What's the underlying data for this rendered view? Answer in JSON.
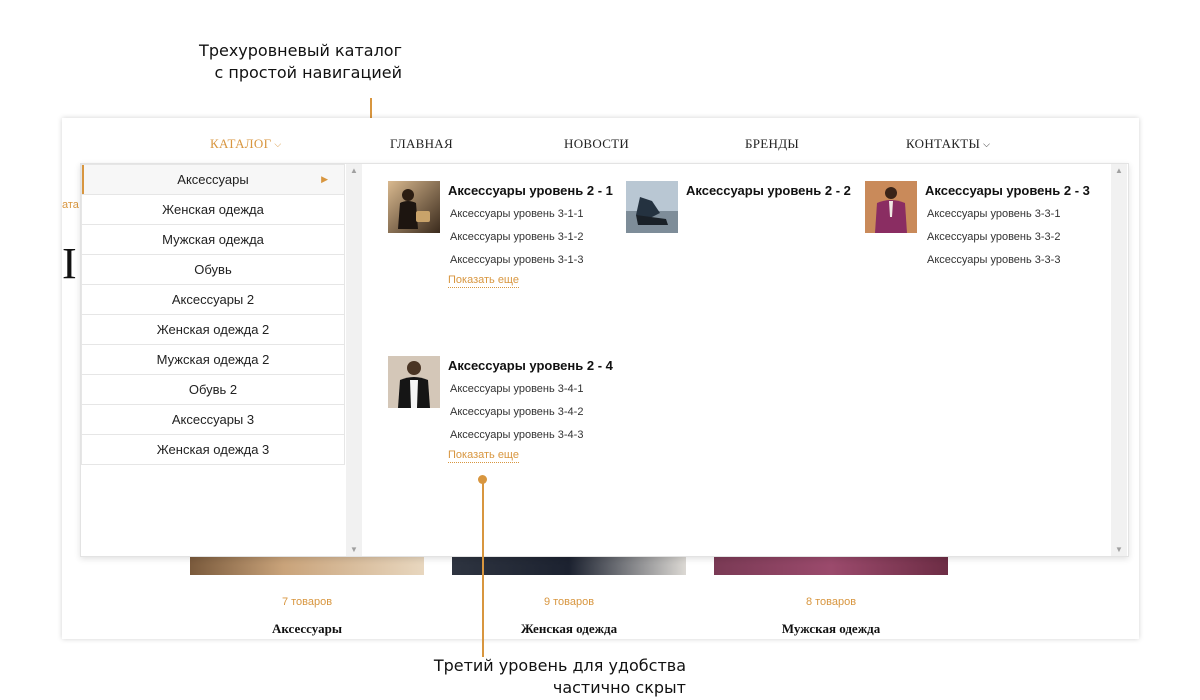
{
  "annotations": {
    "top_line1": "Трехуровневый каталог",
    "top_line2": "с простой навигацией",
    "bottom_line1": "Третий уровень для удобства",
    "bottom_line2": "частично скрыт"
  },
  "nav": {
    "items": [
      {
        "label": "КАТАЛОГ",
        "has_dropdown": true,
        "active": true
      },
      {
        "label": "ГЛАВНАЯ",
        "has_dropdown": false
      },
      {
        "label": "НОВОСТИ",
        "has_dropdown": false
      },
      {
        "label": "БРЕНДЫ",
        "has_dropdown": false
      },
      {
        "label": "КОНТАКТЫ",
        "has_dropdown": true
      }
    ]
  },
  "background": {
    "crumb": "ата",
    "letter": "I",
    "categories": [
      {
        "count": "7 товаров",
        "name": "Аксессуары"
      },
      {
        "count": "9 товаров",
        "name": "Женская одежда"
      },
      {
        "count": "8 товаров",
        "name": "Мужская одежда"
      }
    ]
  },
  "menu": {
    "items": [
      {
        "label": "Аксессуары",
        "active": true
      },
      {
        "label": "Женская одежда"
      },
      {
        "label": "Мужская одежда"
      },
      {
        "label": "Обувь"
      },
      {
        "label": "Аксессуары 2"
      },
      {
        "label": "Женская одежда 2"
      },
      {
        "label": "Мужская одежда 2"
      },
      {
        "label": "Обувь 2"
      },
      {
        "label": "Аксессуары 3"
      },
      {
        "label": "Женская одежда 3"
      }
    ]
  },
  "submenu": [
    {
      "title": "Аксессуары уровень 2 - 1",
      "items": [
        "Аксессуары уровень 3-1-1",
        "Аксессуары уровень 3-1-2",
        "Аксессуары уровень 3-1-3"
      ],
      "more": "Показать еще"
    },
    {
      "title": "Аксессуары уровень 2 - 2",
      "items": [],
      "more": ""
    },
    {
      "title": "Аксессуары уровень 2 - 3",
      "items": [
        "Аксессуары уровень 3-3-1",
        "Аксессуары уровень 3-3-2",
        "Аксессуары уровень 3-3-3"
      ],
      "more": ""
    },
    {
      "title": "Аксессуары уровень 2 - 4",
      "items": [
        "Аксессуары уровень 3-4-1",
        "Аксессуары уровень 3-4-2",
        "Аксессуары уровень 3-4-3"
      ],
      "more": "Показать еще"
    }
  ],
  "colors": {
    "accent": "#d8963f",
    "text": "#222222",
    "border": "#e6e6e6"
  },
  "icons": {
    "nav_chevron": "chevron-down-icon",
    "menu_arrow": "caret-right-icon",
    "scroll_up": "scroll-up-icon",
    "scroll_down": "scroll-down-icon"
  }
}
